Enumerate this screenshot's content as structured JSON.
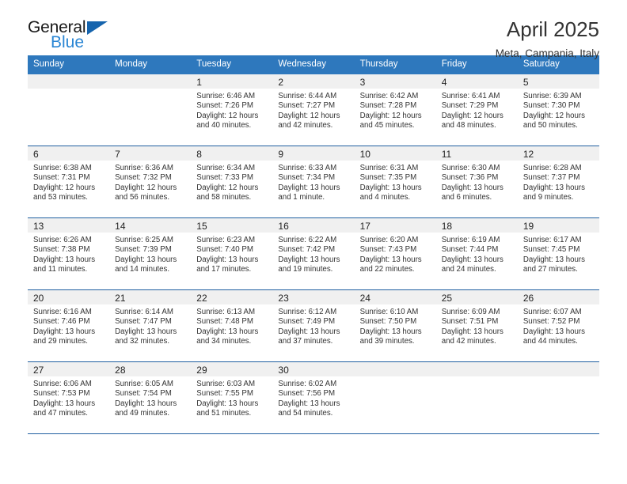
{
  "brand": {
    "name_dark": "General",
    "name_blue": "Blue",
    "triangle_color": "#1664ad",
    "blue_text_color": "#2a86d4"
  },
  "header": {
    "title": "April 2025",
    "subtitle": "Meta, Campania, Italy"
  },
  "colors": {
    "header_band": "#2e78bd",
    "row_rule": "#1f5fa0",
    "daynum_band": "#f0f0f0",
    "text": "#333333"
  },
  "calendar": {
    "day_headers": [
      "Sunday",
      "Monday",
      "Tuesday",
      "Wednesday",
      "Thursday",
      "Friday",
      "Saturday"
    ],
    "weeks": [
      [
        {
          "day": "",
          "lines": []
        },
        {
          "day": "",
          "lines": []
        },
        {
          "day": "1",
          "lines": [
            "Sunrise: 6:46 AM",
            "Sunset: 7:26 PM",
            "Daylight: 12 hours",
            "and 40 minutes."
          ]
        },
        {
          "day": "2",
          "lines": [
            "Sunrise: 6:44 AM",
            "Sunset: 7:27 PM",
            "Daylight: 12 hours",
            "and 42 minutes."
          ]
        },
        {
          "day": "3",
          "lines": [
            "Sunrise: 6:42 AM",
            "Sunset: 7:28 PM",
            "Daylight: 12 hours",
            "and 45 minutes."
          ]
        },
        {
          "day": "4",
          "lines": [
            "Sunrise: 6:41 AM",
            "Sunset: 7:29 PM",
            "Daylight: 12 hours",
            "and 48 minutes."
          ]
        },
        {
          "day": "5",
          "lines": [
            "Sunrise: 6:39 AM",
            "Sunset: 7:30 PM",
            "Daylight: 12 hours",
            "and 50 minutes."
          ]
        }
      ],
      [
        {
          "day": "6",
          "lines": [
            "Sunrise: 6:38 AM",
            "Sunset: 7:31 PM",
            "Daylight: 12 hours",
            "and 53 minutes."
          ]
        },
        {
          "day": "7",
          "lines": [
            "Sunrise: 6:36 AM",
            "Sunset: 7:32 PM",
            "Daylight: 12 hours",
            "and 56 minutes."
          ]
        },
        {
          "day": "8",
          "lines": [
            "Sunrise: 6:34 AM",
            "Sunset: 7:33 PM",
            "Daylight: 12 hours",
            "and 58 minutes."
          ]
        },
        {
          "day": "9",
          "lines": [
            "Sunrise: 6:33 AM",
            "Sunset: 7:34 PM",
            "Daylight: 13 hours",
            "and 1 minute."
          ]
        },
        {
          "day": "10",
          "lines": [
            "Sunrise: 6:31 AM",
            "Sunset: 7:35 PM",
            "Daylight: 13 hours",
            "and 4 minutes."
          ]
        },
        {
          "day": "11",
          "lines": [
            "Sunrise: 6:30 AM",
            "Sunset: 7:36 PM",
            "Daylight: 13 hours",
            "and 6 minutes."
          ]
        },
        {
          "day": "12",
          "lines": [
            "Sunrise: 6:28 AM",
            "Sunset: 7:37 PM",
            "Daylight: 13 hours",
            "and 9 minutes."
          ]
        }
      ],
      [
        {
          "day": "13",
          "lines": [
            "Sunrise: 6:26 AM",
            "Sunset: 7:38 PM",
            "Daylight: 13 hours",
            "and 11 minutes."
          ]
        },
        {
          "day": "14",
          "lines": [
            "Sunrise: 6:25 AM",
            "Sunset: 7:39 PM",
            "Daylight: 13 hours",
            "and 14 minutes."
          ]
        },
        {
          "day": "15",
          "lines": [
            "Sunrise: 6:23 AM",
            "Sunset: 7:40 PM",
            "Daylight: 13 hours",
            "and 17 minutes."
          ]
        },
        {
          "day": "16",
          "lines": [
            "Sunrise: 6:22 AM",
            "Sunset: 7:42 PM",
            "Daylight: 13 hours",
            "and 19 minutes."
          ]
        },
        {
          "day": "17",
          "lines": [
            "Sunrise: 6:20 AM",
            "Sunset: 7:43 PM",
            "Daylight: 13 hours",
            "and 22 minutes."
          ]
        },
        {
          "day": "18",
          "lines": [
            "Sunrise: 6:19 AM",
            "Sunset: 7:44 PM",
            "Daylight: 13 hours",
            "and 24 minutes."
          ]
        },
        {
          "day": "19",
          "lines": [
            "Sunrise: 6:17 AM",
            "Sunset: 7:45 PM",
            "Daylight: 13 hours",
            "and 27 minutes."
          ]
        }
      ],
      [
        {
          "day": "20",
          "lines": [
            "Sunrise: 6:16 AM",
            "Sunset: 7:46 PM",
            "Daylight: 13 hours",
            "and 29 minutes."
          ]
        },
        {
          "day": "21",
          "lines": [
            "Sunrise: 6:14 AM",
            "Sunset: 7:47 PM",
            "Daylight: 13 hours",
            "and 32 minutes."
          ]
        },
        {
          "day": "22",
          "lines": [
            "Sunrise: 6:13 AM",
            "Sunset: 7:48 PM",
            "Daylight: 13 hours",
            "and 34 minutes."
          ]
        },
        {
          "day": "23",
          "lines": [
            "Sunrise: 6:12 AM",
            "Sunset: 7:49 PM",
            "Daylight: 13 hours",
            "and 37 minutes."
          ]
        },
        {
          "day": "24",
          "lines": [
            "Sunrise: 6:10 AM",
            "Sunset: 7:50 PM",
            "Daylight: 13 hours",
            "and 39 minutes."
          ]
        },
        {
          "day": "25",
          "lines": [
            "Sunrise: 6:09 AM",
            "Sunset: 7:51 PM",
            "Daylight: 13 hours",
            "and 42 minutes."
          ]
        },
        {
          "day": "26",
          "lines": [
            "Sunrise: 6:07 AM",
            "Sunset: 7:52 PM",
            "Daylight: 13 hours",
            "and 44 minutes."
          ]
        }
      ],
      [
        {
          "day": "27",
          "lines": [
            "Sunrise: 6:06 AM",
            "Sunset: 7:53 PM",
            "Daylight: 13 hours",
            "and 47 minutes."
          ]
        },
        {
          "day": "28",
          "lines": [
            "Sunrise: 6:05 AM",
            "Sunset: 7:54 PM",
            "Daylight: 13 hours",
            "and 49 minutes."
          ]
        },
        {
          "day": "29",
          "lines": [
            "Sunrise: 6:03 AM",
            "Sunset: 7:55 PM",
            "Daylight: 13 hours",
            "and 51 minutes."
          ]
        },
        {
          "day": "30",
          "lines": [
            "Sunrise: 6:02 AM",
            "Sunset: 7:56 PM",
            "Daylight: 13 hours",
            "and 54 minutes."
          ]
        },
        {
          "day": "",
          "lines": []
        },
        {
          "day": "",
          "lines": []
        },
        {
          "day": "",
          "lines": []
        }
      ]
    ]
  }
}
